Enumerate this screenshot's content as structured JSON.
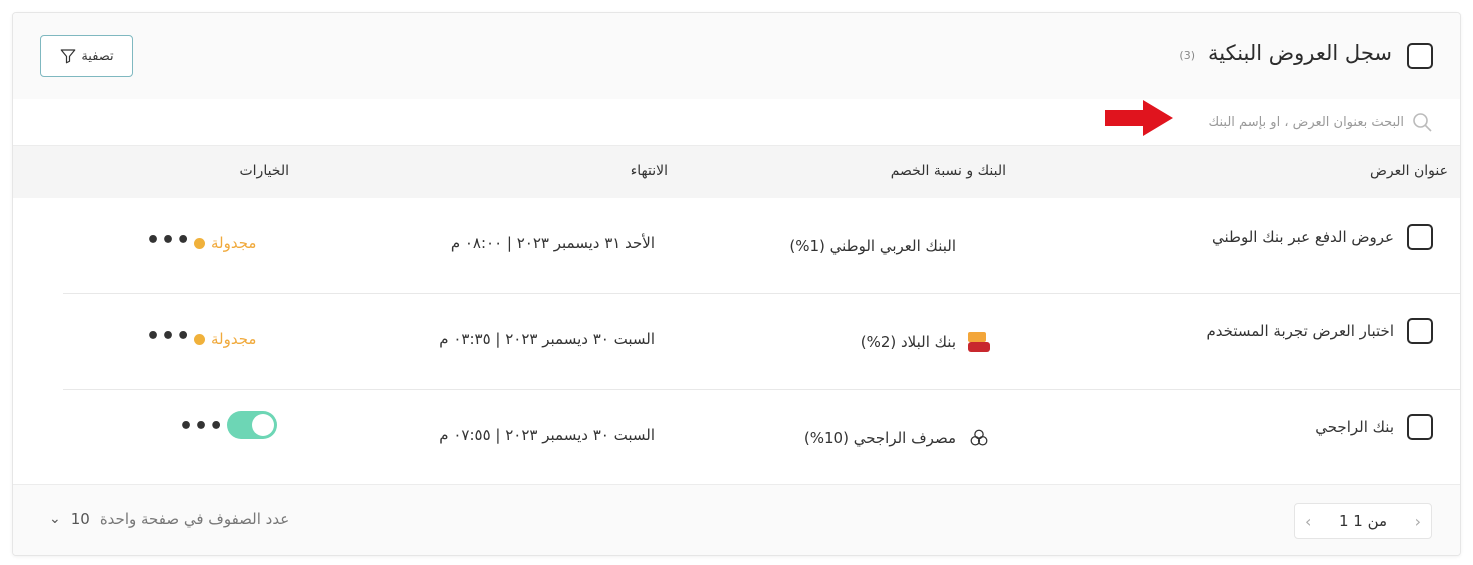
{
  "header": {
    "title": "سجل العروض البنكية",
    "count": "(3)",
    "filter_label": "تصفية"
  },
  "search": {
    "placeholder": "البحث بعنوان العرض ، او بإسم البنك"
  },
  "table": {
    "columns": [
      "عنوان العرض",
      "البنك و نسبة الخصم",
      "الانتهاء",
      "الخيارات"
    ],
    "rows": [
      {
        "title": "عروض الدفع عبر بنك الوطني",
        "bank": "البنك العربي الوطني (1%)",
        "bank_icon": "anb-logo-icon",
        "expiry": "الأحد ٣١ ديسمبر ٢٠٢٣ | ٠٨:٠٠ م",
        "status": "مجدولة",
        "status_color": "#f0a93b"
      },
      {
        "title": "اختبار العرض تجربة المستخدم",
        "bank": "بنك البلاد (2%)",
        "bank_icon": "albilad-logo-icon",
        "expiry": "السبت ٣٠ ديسمبر ٢٠٢٣ | ٠٣:٣٥ م",
        "status": "مجدولة",
        "status_color": "#f0a93b"
      },
      {
        "title": "بنك الراجحي",
        "bank": "مصرف الراجحي (10%)",
        "bank_icon": "alrajhi-logo-icon",
        "expiry": "السبت ٣٠ ديسمبر ٢٠٢٣ | ٠٧:٥٥ م",
        "toggle_on": true,
        "toggle_color": "#6dd6b5"
      }
    ]
  },
  "footer": {
    "pagination": "1 من 1",
    "rows_per_page_label": "عدد الصفوف في صفحة واحدة",
    "rows_per_page_value": "10"
  },
  "annotation": {
    "arrow_color": "#e0141e"
  }
}
